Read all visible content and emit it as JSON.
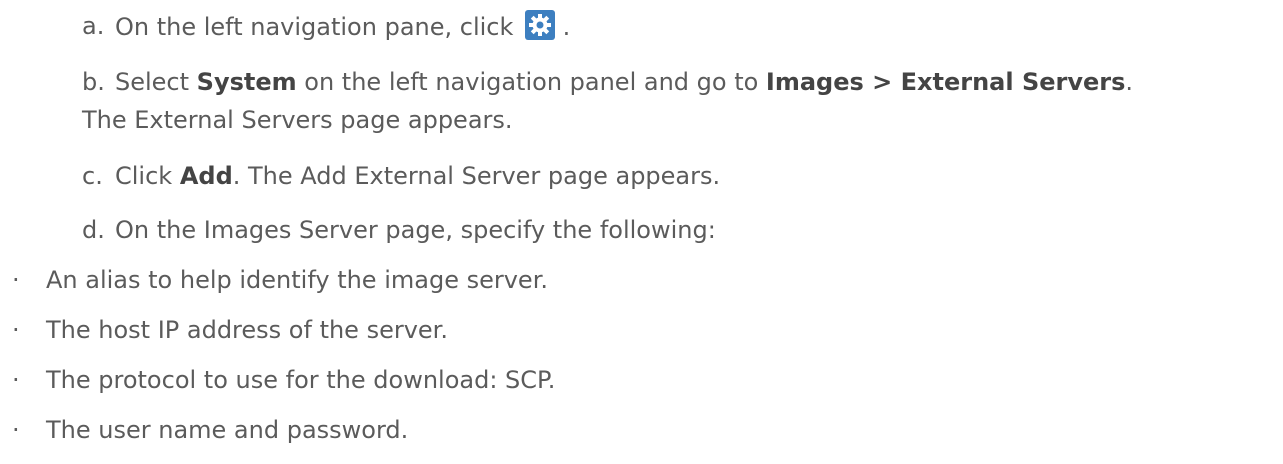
{
  "steps": [
    {
      "marker": "a.",
      "before": "On the left navigation pane, click",
      "icon": "gear-icon",
      "after": "."
    },
    {
      "marker": "b.",
      "t1": "Select ",
      "b1": "System",
      "t2": " on the left navigation panel and go to ",
      "b2": "Images > External Servers",
      "t3": ".",
      "line2": "The External Servers page appears."
    },
    {
      "marker": "c.",
      "t1": "Click ",
      "b1": "Add",
      "t2": ". The Add External Server page appears."
    },
    {
      "marker": "d.",
      "text": "On the Images Server page, specify the following:"
    }
  ],
  "bullets": [
    {
      "dot": "·",
      "text": "An alias to help identify the image server."
    },
    {
      "dot": "·",
      "text": "The host IP address of the server."
    },
    {
      "dot": "·",
      "text": "The protocol to use for the download: SCP."
    },
    {
      "dot": "·",
      "text": "The user name and password."
    }
  ],
  "colors": {
    "text": "#5b5b5b",
    "icon_bg": "#3d7fc0"
  }
}
